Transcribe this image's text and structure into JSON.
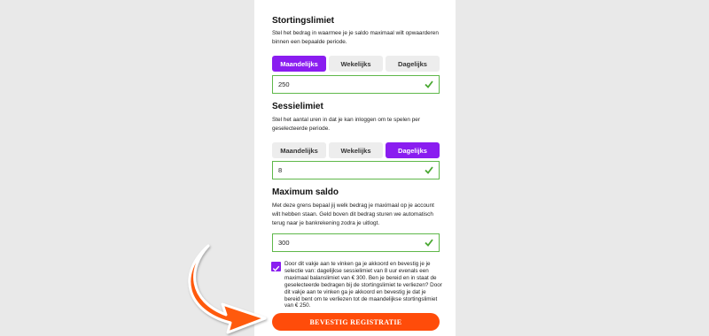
{
  "colors": {
    "accent": "#8a1df0",
    "valid": "#5fb84a",
    "confirm": "#ff4c0a"
  },
  "deposit_limit": {
    "title": "Stortingslimiet",
    "description": "Stel het bedrag in waarmee je je saldo maximaal wilt opwaarderen binnen een bepaalde periode.",
    "options": [
      "Maandelijks",
      "Wekelijks",
      "Dagelijks"
    ],
    "selected": "Maandelijks",
    "value": "250"
  },
  "session_limit": {
    "title": "Sessielimiet",
    "description": "Stel het aantal uren in dat je kan inloggen om te spelen per geselecteerde periode.",
    "options": [
      "Maandelijks",
      "Wekelijks",
      "Dagelijks"
    ],
    "selected": "Dagelijks",
    "value": "8"
  },
  "max_balance": {
    "title": "Maximum saldo",
    "description": "Met deze grens bepaal jij welk bedrag je maximaal op je account wilt hebben staan. Geld boven dit bedrag sturen we automatisch terug naar je bankrekening zodra je uitlogt.",
    "value": "300"
  },
  "consent": {
    "checked": true,
    "text": "Door dit vakje aan te vinken ga je akkoord en bevestig je je selectie van: dagelijkse sessielimiet van 8 uur evenals een maximaal balanslimiet van € 300. Ben je bereid en in staat de geselecteerde bedragen bij de stortingslimiet te verliezen? Door dit vakje aan te vinken ga je akkoord en bevestig je dat je bereid bent om te verliezen tot de maandelijkse stortingslimiet van € 250."
  },
  "confirm_button": {
    "label": "BEVESTIG REGISTRATIE"
  }
}
